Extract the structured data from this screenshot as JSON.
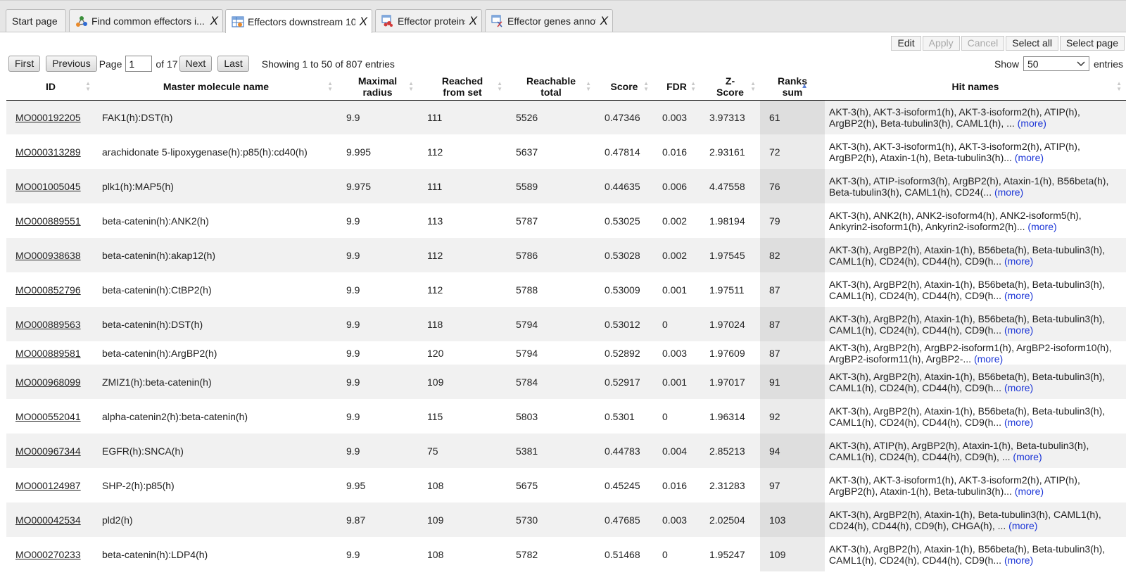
{
  "tabs": [
    {
      "label": "Start page",
      "icon": "",
      "active": false
    },
    {
      "label": "Find common effectors i...",
      "icon": "network-icon",
      "active": false
    },
    {
      "label": "Effectors downstream 10",
      "icon": "table-icon",
      "active": true
    },
    {
      "label": "Effector proteins",
      "icon": "protein-icon",
      "active": false
    },
    {
      "label": "Effector genes annot",
      "icon": "genes-icon",
      "active": false
    }
  ],
  "tab_close": "X",
  "toolbar": {
    "edit": "Edit",
    "apply": "Apply",
    "cancel": "Cancel",
    "select_all": "Select all",
    "select_page": "Select page"
  },
  "pager": {
    "first": "First",
    "previous": "Previous",
    "page_label": "Page",
    "page_value": "1",
    "of_label": "of 17",
    "next": "Next",
    "last": "Last",
    "showing": "Showing 1 to 50 of 807 entries"
  },
  "show": {
    "label": "Show",
    "value": "50",
    "suffix": "entries"
  },
  "columns": [
    {
      "key": "id",
      "label": "ID",
      "sort": "both"
    },
    {
      "key": "name",
      "label": "Master molecule name",
      "sort": "both"
    },
    {
      "key": "radius",
      "label": "Maximal radius",
      "sort": "both"
    },
    {
      "key": "reached",
      "label": "Reached from set",
      "sort": "both"
    },
    {
      "key": "total",
      "label": "Reachable total",
      "sort": "both"
    },
    {
      "key": "score",
      "label": "Score",
      "sort": "both"
    },
    {
      "key": "fdr",
      "label": "FDR",
      "sort": "both"
    },
    {
      "key": "zscore",
      "label": "Z-Score",
      "sort": "both"
    },
    {
      "key": "ranks",
      "label": "Ranks sum",
      "sort": "asc"
    },
    {
      "key": "hits",
      "label": "Hit names",
      "sort": "both"
    }
  ],
  "more_label": "(more)",
  "rows": [
    {
      "id": "MO000192205",
      "name": "FAK1(h):DST(h)",
      "radius": "9.9",
      "reached": "111",
      "total": "5526",
      "score": "0.47346",
      "fdr": "0.003",
      "zscore": "3.97313",
      "ranks": "61",
      "hits": "AKT-3(h), AKT-3-isoform1(h), AKT-3-isoform2(h), ATIP(h), ArgBP2(h), Beta-tubulin3(h), CAML1(h), ..."
    },
    {
      "id": "MO000313289",
      "name": "arachidonate 5-lipoxygenase(h):p85(h):cd40(h)",
      "radius": "9.995",
      "reached": "112",
      "total": "5637",
      "score": "0.47814",
      "fdr": "0.016",
      "zscore": "2.93161",
      "ranks": "72",
      "hits": "AKT-3(h), AKT-3-isoform1(h), AKT-3-isoform2(h), ATIP(h), ArgBP2(h), Ataxin-1(h), Beta-tubulin3(h)..."
    },
    {
      "id": "MO001005045",
      "name": "plk1(h):MAP5(h)",
      "radius": "9.975",
      "reached": "111",
      "total": "5589",
      "score": "0.44635",
      "fdr": "0.006",
      "zscore": "4.47558",
      "ranks": "76",
      "hits": "AKT-3(h), ATIP-isoform3(h), ArgBP2(h), Ataxin-1(h), B56beta(h), Beta-tubulin3(h), CAML1(h), CD24(..."
    },
    {
      "id": "MO000889551",
      "name": "beta-catenin(h):ANK2(h)",
      "radius": "9.9",
      "reached": "113",
      "total": "5787",
      "score": "0.53025",
      "fdr": "0.002",
      "zscore": "1.98194",
      "ranks": "79",
      "hits": "AKT-3(h), ANK2(h), ANK2-isoform4(h), ANK2-isoform5(h), Ankyrin2-isoform1(h), Ankyrin2-isoform2(h)..."
    },
    {
      "id": "MO000938638",
      "name": "beta-catenin(h):akap12(h)",
      "radius": "9.9",
      "reached": "112",
      "total": "5786",
      "score": "0.53028",
      "fdr": "0.002",
      "zscore": "1.97545",
      "ranks": "82",
      "hits": "AKT-3(h), ArgBP2(h), Ataxin-1(h), B56beta(h), Beta-tubulin3(h), CAML1(h), CD24(h), CD44(h), CD9(h..."
    },
    {
      "id": "MO000852796",
      "name": "beta-catenin(h):CtBP2(h)",
      "radius": "9.9",
      "reached": "112",
      "total": "5788",
      "score": "0.53009",
      "fdr": "0.001",
      "zscore": "1.97511",
      "ranks": "87",
      "hits": "AKT-3(h), ArgBP2(h), Ataxin-1(h), B56beta(h), Beta-tubulin3(h), CAML1(h), CD24(h), CD44(h), CD9(h..."
    },
    {
      "id": "MO000889563",
      "name": "beta-catenin(h):DST(h)",
      "radius": "9.9",
      "reached": "118",
      "total": "5794",
      "score": "0.53012",
      "fdr": "0",
      "zscore": "1.97024",
      "ranks": "87",
      "hits": "AKT-3(h), ArgBP2(h), Ataxin-1(h), B56beta(h), Beta-tubulin3(h), CAML1(h), CD24(h), CD44(h), CD9(h..."
    },
    {
      "id": "MO000889581",
      "name": "beta-catenin(h):ArgBP2(h)",
      "radius": "9.9",
      "reached": "120",
      "total": "5794",
      "score": "0.52892",
      "fdr": "0.003",
      "zscore": "1.97609",
      "ranks": "87",
      "hits": "AKT-3(h), ArgBP2(h), ArgBP2-isoform1(h), ArgBP2-isoform10(h), ArgBP2-isoform11(h), ArgBP2-..."
    },
    {
      "id": "MO000968099",
      "name": "ZMIZ1(h):beta-catenin(h)",
      "radius": "9.9",
      "reached": "109",
      "total": "5784",
      "score": "0.52917",
      "fdr": "0.001",
      "zscore": "1.97017",
      "ranks": "91",
      "hits": "AKT-3(h), ArgBP2(h), Ataxin-1(h), B56beta(h), Beta-tubulin3(h), CAML1(h), CD24(h), CD44(h), CD9(h..."
    },
    {
      "id": "MO000552041",
      "name": "alpha-catenin2(h):beta-catenin(h)",
      "radius": "9.9",
      "reached": "115",
      "total": "5803",
      "score": "0.5301",
      "fdr": "0",
      "zscore": "1.96314",
      "ranks": "92",
      "hits": "AKT-3(h), ArgBP2(h), Ataxin-1(h), B56beta(h), Beta-tubulin3(h), CAML1(h), CD24(h), CD44(h), CD9(h..."
    },
    {
      "id": "MO000967344",
      "name": "EGFR(h):SNCA(h)",
      "radius": "9.9",
      "reached": "75",
      "total": "5381",
      "score": "0.44783",
      "fdr": "0.004",
      "zscore": "2.85213",
      "ranks": "94",
      "hits": "AKT-3(h), ATIP(h), ArgBP2(h), Ataxin-1(h), Beta-tubulin3(h), CAML1(h), CD24(h), CD44(h), CD9(h), ..."
    },
    {
      "id": "MO000124987",
      "name": "SHP-2(h):p85(h)",
      "radius": "9.95",
      "reached": "108",
      "total": "5675",
      "score": "0.45245",
      "fdr": "0.016",
      "zscore": "2.31283",
      "ranks": "97",
      "hits": "AKT-3(h), AKT-3-isoform1(h), AKT-3-isoform2(h), ATIP(h), ArgBP2(h), Ataxin-1(h), Beta-tubulin3(h)..."
    },
    {
      "id": "MO000042534",
      "name": "pld2(h)",
      "radius": "9.87",
      "reached": "109",
      "total": "5730",
      "score": "0.47685",
      "fdr": "0.003",
      "zscore": "2.02504",
      "ranks": "103",
      "hits": "AKT-3(h), ArgBP2(h), Ataxin-1(h), Beta-tubulin3(h), CAML1(h), CD24(h), CD44(h), CD9(h), CHGA(h), ..."
    },
    {
      "id": "MO000270233",
      "name": "beta-catenin(h):LDP4(h)",
      "radius": "9.9",
      "reached": "108",
      "total": "5782",
      "score": "0.51468",
      "fdr": "0",
      "zscore": "1.95247",
      "ranks": "109",
      "hits": "AKT-3(h), ArgBP2(h), Ataxin-1(h), B56beta(h), Beta-tubulin3(h), CAML1(h), CD24(h), CD44(h), CD9(h..."
    }
  ]
}
